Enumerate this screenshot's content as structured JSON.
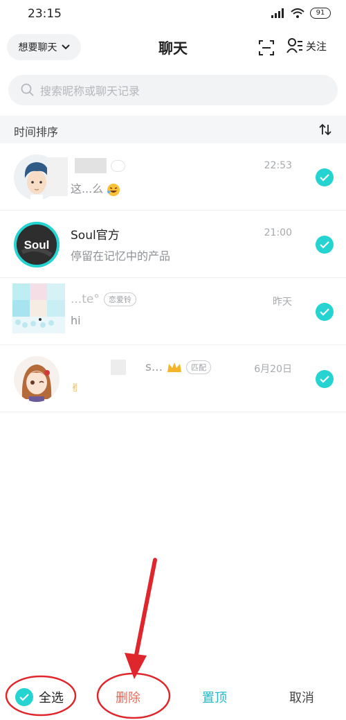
{
  "status_bar": {
    "time": "23:15",
    "battery": "91"
  },
  "header": {
    "mood_label": "想要聊天",
    "title": "聊天",
    "follow_label": "关注"
  },
  "search": {
    "placeholder": "搜索昵称或聊天记录"
  },
  "sort": {
    "label": "时间排序"
  },
  "chats": [
    {
      "name": "",
      "message": "这...么",
      "time": "22:53",
      "selected": true
    },
    {
      "name": "Soul官方",
      "message": "停留在记忆中的产品",
      "time": "21:00",
      "selected": true
    },
    {
      "name": "...te°",
      "tag": "恋爱铃",
      "message": "hi",
      "time": "昨天",
      "selected": true
    },
    {
      "name": "s...",
      "tag": "匹配",
      "message": "✌",
      "time": "6月20日",
      "selected": true
    }
  ],
  "bottom_bar": {
    "select_all_label": "全选",
    "delete_label": "删除",
    "pin_label": "置顶",
    "cancel_label": "取消"
  },
  "colors": {
    "accent": "#25d4d0",
    "delete": "#e56b5d",
    "pin": "#25b8c8",
    "annotation": "#e0262d"
  }
}
